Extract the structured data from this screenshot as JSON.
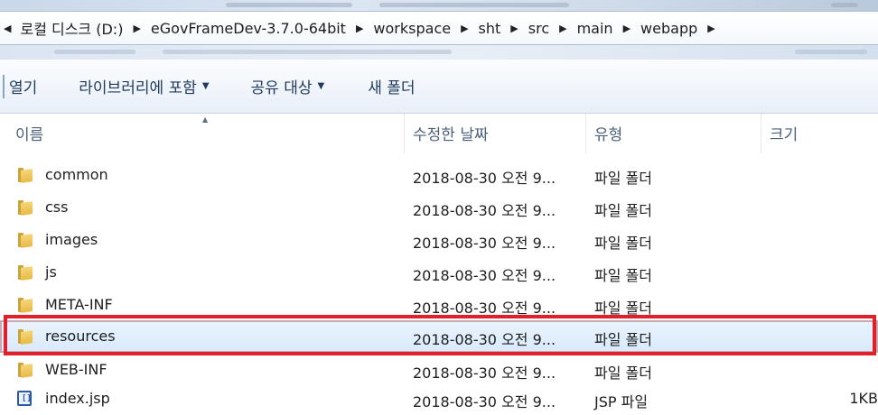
{
  "address": {
    "crumbs": [
      "로컬 디스크 (D:)",
      "eGovFrameDev-3.7.0-64bit",
      "workspace",
      "sht",
      "src",
      "main",
      "webapp"
    ]
  },
  "toolbar": {
    "open_label": "열기",
    "include_library_label": "라이브러리에 포함",
    "share_label": "공유 대상",
    "new_folder_label": "새 폴더"
  },
  "columns": {
    "name": "이름",
    "date_modified": "수정한 날짜",
    "type": "유형",
    "size": "크기"
  },
  "files": [
    {
      "name": "common",
      "date": "2018-08-30 오전 9...",
      "type": "파일 폴더",
      "size": "",
      "icon": "folder-icon"
    },
    {
      "name": "css",
      "date": "2018-08-30 오전 9...",
      "type": "파일 폴더",
      "size": "",
      "icon": "folder-icon"
    },
    {
      "name": "images",
      "date": "2018-08-30 오전 9...",
      "type": "파일 폴더",
      "size": "",
      "icon": "folder-icon"
    },
    {
      "name": "js",
      "date": "2018-08-30 오전 9...",
      "type": "파일 폴더",
      "size": "",
      "icon": "folder-icon"
    },
    {
      "name": "META-INF",
      "date": "2018-08-30 오전 9...",
      "type": "파일 폴더",
      "size": "",
      "icon": "folder-icon"
    },
    {
      "name": "resources",
      "date": "2018-08-30 오전 9...",
      "type": "파일 폴더",
      "size": "",
      "icon": "folder-icon",
      "selected": true
    },
    {
      "name": "WEB-INF",
      "date": "2018-08-30 오전 9...",
      "type": "파일 폴더",
      "size": "",
      "icon": "folder-icon"
    },
    {
      "name": "index.jsp",
      "date": "2018-08-30 오전 9...",
      "type": "JSP 파일",
      "size": "1KB",
      "icon": "jsp-file-icon"
    }
  ],
  "colors": {
    "highlight": "#e2202c",
    "selection": "#d9eafc"
  }
}
